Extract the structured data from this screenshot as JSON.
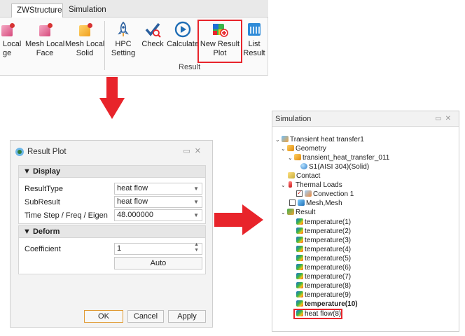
{
  "ribbon": {
    "tabs": [
      "ZWStructure",
      "Simulation"
    ],
    "buttons": [
      {
        "label": "Local\nge",
        "icon": "mesh-local-edge-icon"
      },
      {
        "label": "Mesh Local\nFace",
        "icon": "mesh-local-face-icon"
      },
      {
        "label": "Mesh Local\nSolid",
        "icon": "mesh-local-solid-icon"
      },
      {
        "label": "HPC\nSetting",
        "icon": "hpc-rocket-icon"
      },
      {
        "label": "Check",
        "icon": "check-icon"
      },
      {
        "label": "Calculate",
        "icon": "calculate-play-icon"
      },
      {
        "label": "New Result\nPlot",
        "icon": "new-result-plot-icon"
      },
      {
        "label": "List\nResult",
        "icon": "list-result-icon"
      }
    ],
    "group_label": "Result"
  },
  "dialog": {
    "title": "Result Plot",
    "display_section": "▼ Display",
    "deform_section": "▼ Deform",
    "fields": [
      {
        "label": "ResultType",
        "value": "heat flow"
      },
      {
        "label": "SubResult",
        "value": "heat flow"
      },
      {
        "label": "Time Step /  Freq / Eigen",
        "value": "48.000000"
      }
    ],
    "coefficient_label": "Coefficient",
    "coefficient_value": "1",
    "auto_label": "Auto",
    "ok_label": "OK",
    "cancel_label": "Cancel",
    "apply_label": "Apply"
  },
  "simulation": {
    "title": "Simulation",
    "tree": {
      "root": "Transient heat transfer1",
      "geometry": "Geometry",
      "part": "transient_heat_transfer_011",
      "solid": "S1(AISI 304)(Solid)",
      "contact": "Contact",
      "thermal_loads": "Thermal Loads",
      "convection": "Convection 1",
      "mesh": "Mesh,Mesh",
      "result": "Result",
      "results": [
        "temperature(1)",
        "temperature(2)",
        "temperature(3)",
        "temperature(4)",
        "temperature(5)",
        "temperature(6)",
        "temperature(7)",
        "temperature(8)",
        "temperature(9)",
        "temperature(10)",
        "heat flow(8)"
      ]
    }
  },
  "colors": {
    "highlight_red": "#e8242b",
    "accent_orange": "#e09a33"
  }
}
